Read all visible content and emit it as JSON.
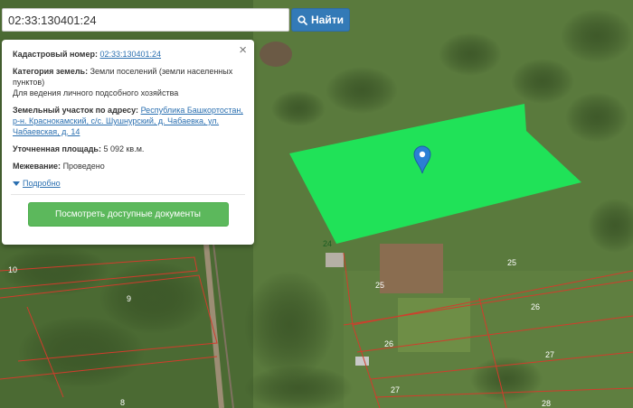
{
  "search": {
    "value": "02:33:130401:24",
    "button_label": "Найти"
  },
  "popup": {
    "cadastral_label": "Кадастровый номер:",
    "cadastral_value": "02:33:130401:24",
    "category_label": "Категория земель:",
    "category_value": "Земли поселений (земли населенных пунктов)",
    "use_value": "Для ведения личного подсобного хозяйства",
    "address_label": "Земельный участок по адресу:",
    "address_value": "Республика Башкортостан, р-н. Краснокамский, с/с. Шушнурский, д. Чабаевка, ул. Чабаевская, д. 14",
    "area_label": "Уточненная площадь:",
    "area_value": "5 092 кв.м.",
    "survey_label": "Межевание:",
    "survey_value": "Проведено",
    "more_label": "Подробно",
    "docs_button": "Посмотреть доступные документы",
    "close_glyph": "×"
  },
  "map_labels": {
    "l24": "24",
    "l25a": "25",
    "l25b": "25",
    "l26a": "26",
    "l26b": "26",
    "l27a": "27",
    "l27b": "27",
    "l28": "28",
    "l10": "10",
    "l9": "9",
    "l8": "8"
  },
  "colors": {
    "highlight": "#1ee85a",
    "marker": "#2b7fd4",
    "boundary": "#d23c2c"
  },
  "icons": {
    "search": "search-icon",
    "marker": "map-marker-icon",
    "close": "close-icon",
    "caret": "caret-down-icon"
  }
}
